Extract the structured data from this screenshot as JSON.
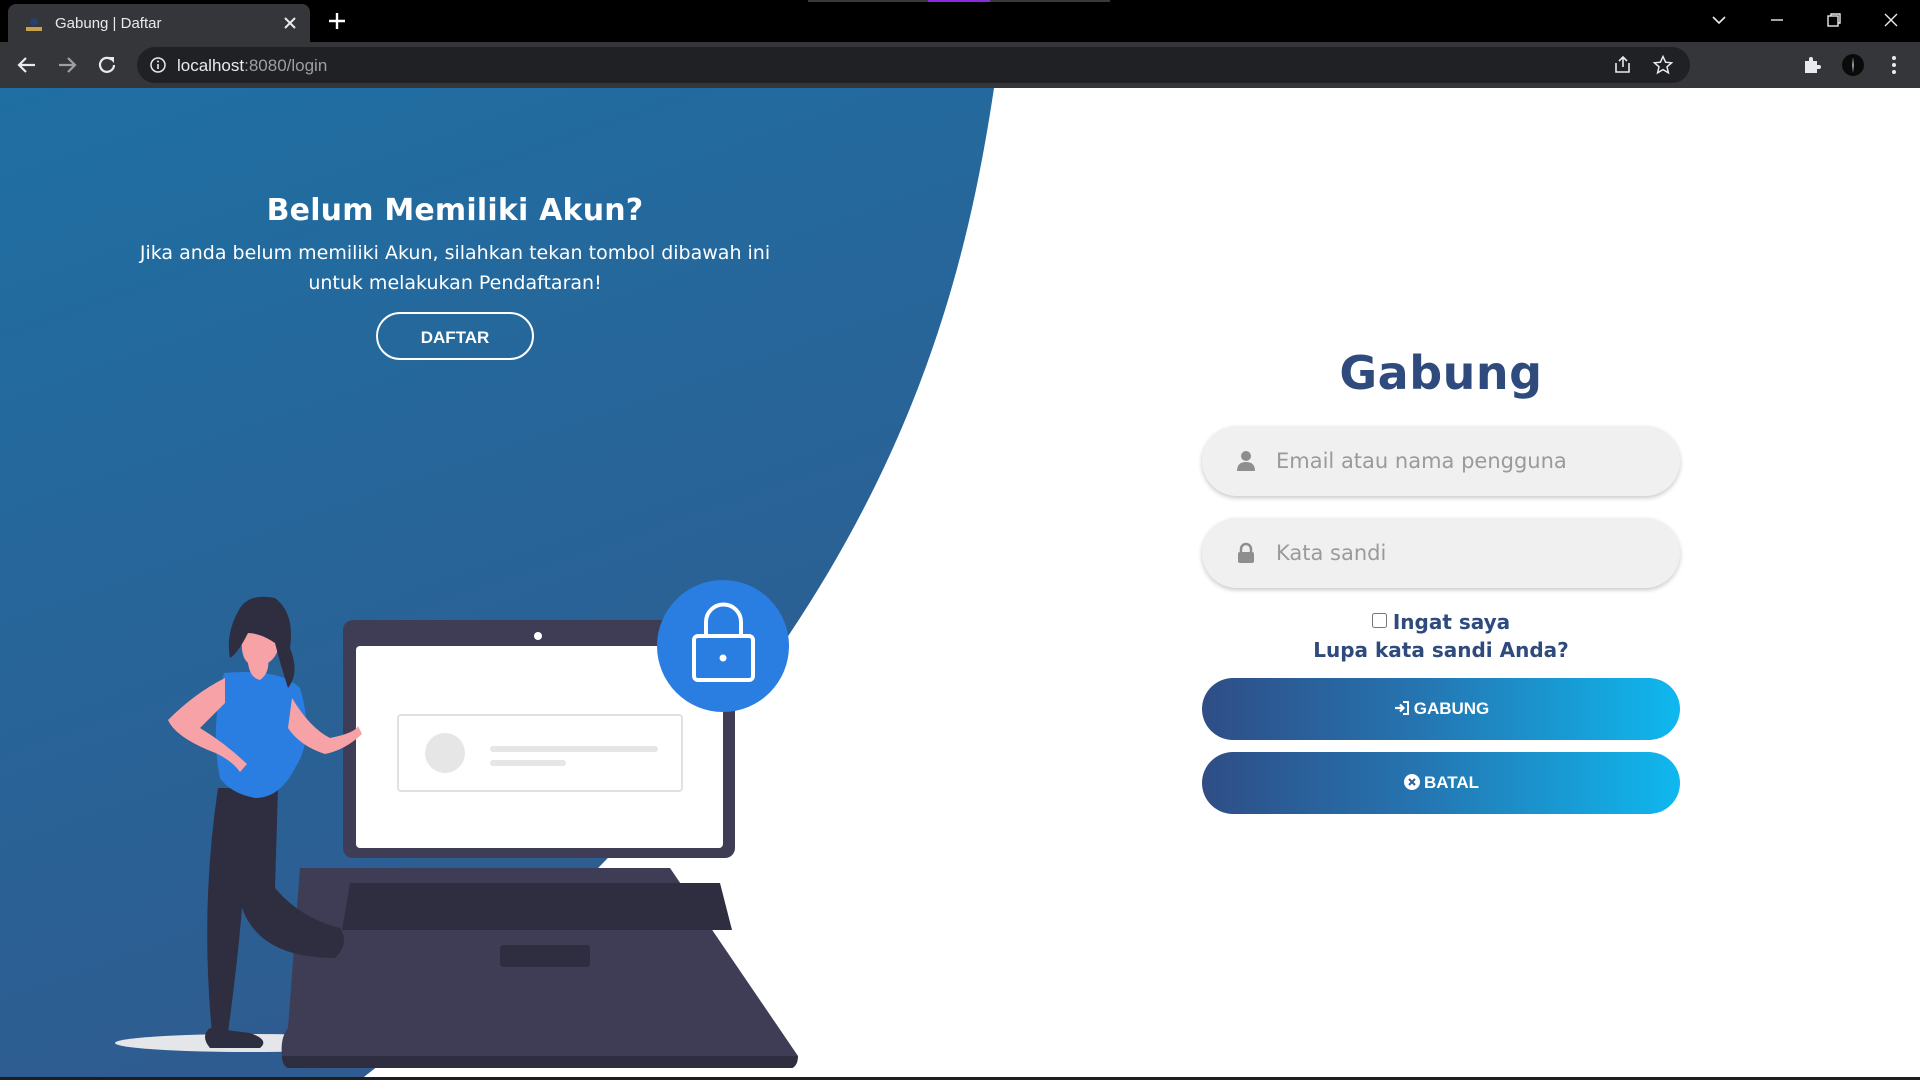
{
  "browser": {
    "tab_title": "Gabung | Daftar",
    "url_host": "localhost",
    "url_path": ":8080/login"
  },
  "left_panel": {
    "heading": "Belum Memiliki Akun?",
    "text": "Jika anda belum memiliki Akun, silahkan tekan tombol dibawah ini untuk melakukan Pendaftaran!",
    "register_button": "DAFTAR"
  },
  "login_form": {
    "title": "Gabung",
    "email_placeholder": "Email atau nama pengguna",
    "password_placeholder": "Kata sandi",
    "remember_label": "Ingat saya",
    "forgot_link": "Lupa kata sandi Anda?",
    "login_button": "GABUNG",
    "cancel_button": "BATAL"
  },
  "colors": {
    "panel_gradient_top": "#1f6fa3",
    "panel_gradient_bottom": "#2f5b8f",
    "accent": "#2f4a7d",
    "button_gradient_end": "#0fb8ef"
  }
}
